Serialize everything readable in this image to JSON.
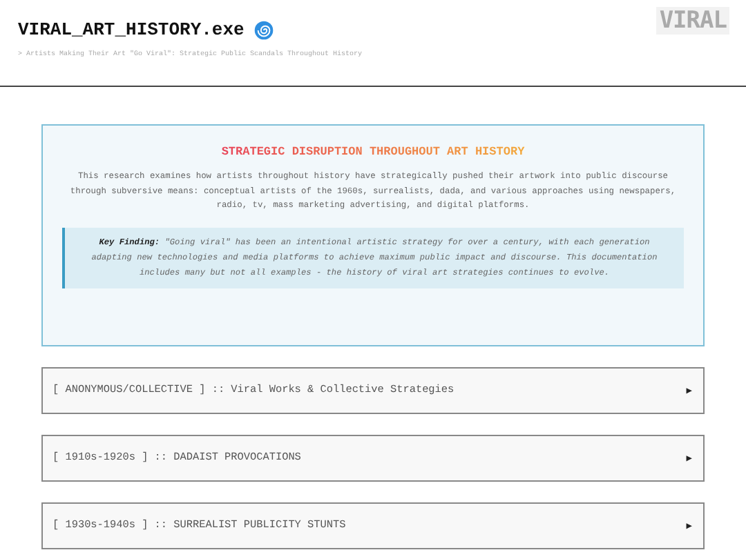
{
  "header": {
    "title": "VIRAL_ART_HISTORY.exe",
    "subtitle": "> Artists Making Their Art \"Go Viral\": Strategic Public Scandals Throughout History",
    "logo": "VIRAL"
  },
  "intro": {
    "heading": "STRATEGIC DISRUPTION THROUGHOUT ART HISTORY",
    "text": "This research examines how artists throughout history have strategically pushed their artwork into public discourse through subversive means: conceptual artists of the 1960s, surrealists, dada, and various approaches using newspapers, radio, tv, mass marketing advertising, and digital platforms.",
    "finding": "**Key Finding:** \"Going viral\" has been an intentional artistic strategy for over a century, with each generation adapting new technologies and media platforms to achieve maximum public impact and discourse. This documentation includes many but not all examples - the history of viral art strategies continues to evolve."
  },
  "sections": [
    {
      "label": "[ ANONYMOUS/COLLECTIVE ] :: Viral Works & Collective Strategies",
      "arrow": "▶",
      "expanded": false
    },
    {
      "label": "[ 1910s-1920s ] :: DADAIST PROVOCATIONS",
      "arrow": "▶",
      "expanded": false
    },
    {
      "label": "[ 1930s-1940s ] :: SURREALIST PUBLICITY STUNTS",
      "arrow": "▶",
      "expanded": false
    }
  ]
}
